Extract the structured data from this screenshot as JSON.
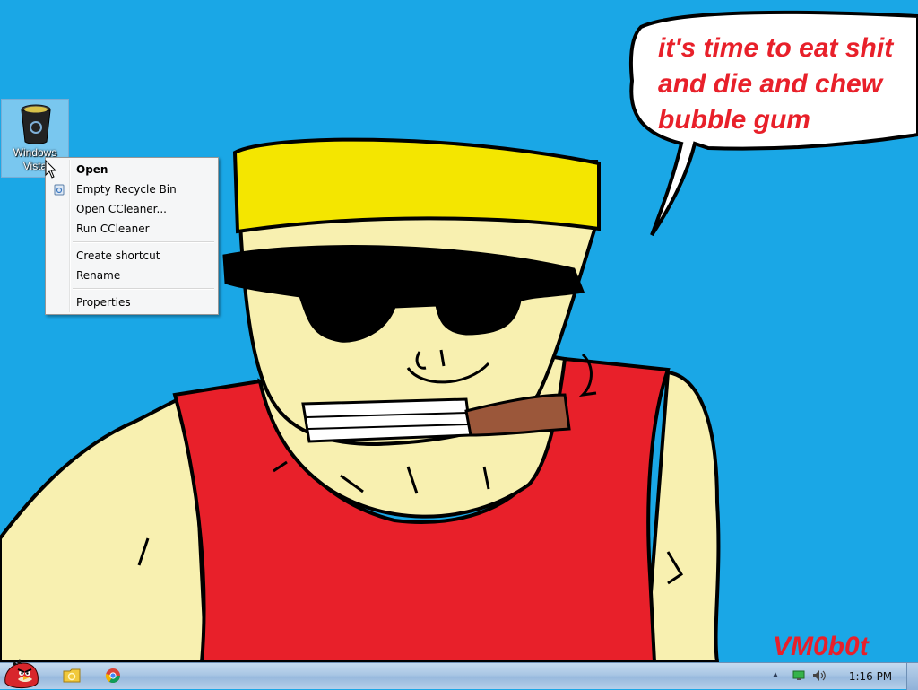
{
  "wallpaper": {
    "speech_lines": [
      "it's time to eat shit",
      "and die and chew",
      "bubble gum"
    ],
    "signature": "VM0b0t",
    "colors": {
      "sky": "#1aa7e6",
      "text_red": "#e8202a",
      "hat": "#f4e600",
      "skin": "#f8f0b0",
      "shirt": "#e8202a",
      "cigar": "#9b573a"
    }
  },
  "desktop": {
    "icon_label_line1": "Windows",
    "icon_label_line2": "Vista",
    "icon": "recycle-bin-icon"
  },
  "context_menu": {
    "items": [
      {
        "label": "Open",
        "bold": true
      },
      {
        "label": "Empty Recycle Bin",
        "icon": "recycle-bin-icon"
      },
      {
        "label": "Open CCleaner..."
      },
      {
        "label": "Run CCleaner"
      },
      {
        "label": "Create shortcut"
      },
      {
        "label": "Rename"
      },
      {
        "label": "Properties"
      }
    ]
  },
  "taskbar": {
    "start_icon": "angry-bird-icon",
    "pinned": [
      "explorer-icon",
      "chrome-icon"
    ],
    "tray": [
      "show-hidden-icons-arrow",
      "network-icon",
      "volume-icon"
    ],
    "clock": "1:16 PM"
  }
}
